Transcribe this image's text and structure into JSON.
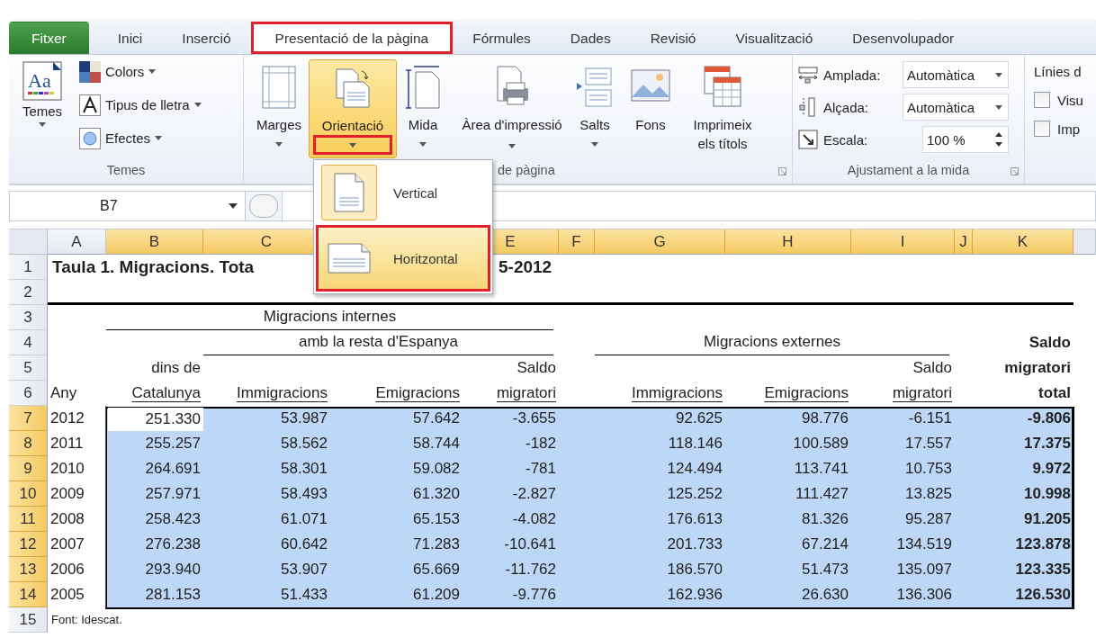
{
  "ribbon_tabs": [
    {
      "label": "Fitxer",
      "kind": "file",
      "selected": false,
      "highlighted": false
    },
    {
      "label": "Inici",
      "kind": "tab",
      "selected": false,
      "highlighted": false
    },
    {
      "label": "Inserció",
      "kind": "tab",
      "selected": false,
      "highlighted": false
    },
    {
      "label": "Presentació de la pàgina",
      "kind": "tab",
      "selected": true,
      "highlighted": true
    },
    {
      "label": "Fórmules",
      "kind": "tab",
      "selected": false,
      "highlighted": false
    },
    {
      "label": "Dades",
      "kind": "tab",
      "selected": false,
      "highlighted": false
    },
    {
      "label": "Revisió",
      "kind": "tab",
      "selected": false,
      "highlighted": false
    },
    {
      "label": "Visualització",
      "kind": "tab",
      "selected": false,
      "highlighted": false
    },
    {
      "label": "Desenvolupador",
      "kind": "tab",
      "selected": false,
      "highlighted": false
    }
  ],
  "themes_group": {
    "label": "Temes",
    "big_button": {
      "label": "Temes",
      "icon_text": "Aa"
    },
    "items": [
      {
        "label": "Colors",
        "kind": "colors"
      },
      {
        "label": "Tipus de lletra",
        "kind": "fonts"
      },
      {
        "label": "Efectes",
        "kind": "effects"
      }
    ]
  },
  "page_setup_group": {
    "label": "de pàgina",
    "buttons": [
      {
        "label": "Marges",
        "kind": "margins",
        "dropdown": true,
        "pressed": false,
        "highlighted": false
      },
      {
        "label": "Orientació",
        "kind": "orientation",
        "dropdown": true,
        "pressed": true,
        "highlighted": true
      },
      {
        "label": "Mida",
        "kind": "size",
        "dropdown": true,
        "pressed": false,
        "highlighted": false
      },
      {
        "label": "Àrea d'impressió",
        "kind": "print-area",
        "dropdown": true,
        "pressed": false,
        "highlighted": false
      },
      {
        "label": "Salts",
        "kind": "breaks",
        "dropdown": true,
        "pressed": false,
        "highlighted": false
      },
      {
        "label": "Fons",
        "kind": "background",
        "dropdown": false,
        "pressed": false,
        "highlighted": false
      },
      {
        "label": "Imprimeix els títols",
        "kind": "print-titles",
        "dropdown": false,
        "pressed": false,
        "highlighted": false
      }
    ]
  },
  "scale_group": {
    "label": "Ajustament a la mida",
    "rows": [
      {
        "label": "Amplada:",
        "kind": "dropdown",
        "value": "Automàtica"
      },
      {
        "label": "Alçada:",
        "kind": "dropdown",
        "value": "Automàtica"
      },
      {
        "label": "Escala:",
        "kind": "spinner",
        "value": "100 %"
      }
    ]
  },
  "sheet_options_group": {
    "label": "Línies d",
    "checkboxes": [
      {
        "label": "Visu",
        "checked": false
      },
      {
        "label": "Imp",
        "checked": false
      }
    ]
  },
  "name_box": {
    "value": "B7"
  },
  "orientation_menu": {
    "items": [
      {
        "label": "Vertical",
        "kind": "portrait",
        "selected": true,
        "hovered": false,
        "highlighted": false
      },
      {
        "label": "Horitzontal",
        "kind": "landscape",
        "selected": false,
        "hovered": true,
        "highlighted": true
      }
    ]
  },
  "sheet": {
    "columns": [
      {
        "label": "A",
        "selected": false
      },
      {
        "label": "B",
        "selected": true
      },
      {
        "label": "C",
        "selected": true
      },
      {
        "label": "E",
        "selected": true
      },
      {
        "label": "F",
        "selected": true
      },
      {
        "label": "G",
        "selected": true
      },
      {
        "label": "H",
        "selected": true
      },
      {
        "label": "I",
        "selected": true
      },
      {
        "label": "J",
        "selected": true
      },
      {
        "label": "K",
        "selected": true
      }
    ],
    "row_numbers": [
      {
        "label": "1",
        "selected": false
      },
      {
        "label": "2",
        "selected": false
      },
      {
        "label": "3",
        "selected": false
      },
      {
        "label": "4",
        "selected": false
      },
      {
        "label": "5",
        "selected": false
      },
      {
        "label": "6",
        "selected": false
      },
      {
        "label": "7",
        "selected": true
      },
      {
        "label": "8",
        "selected": true
      },
      {
        "label": "9",
        "selected": true
      },
      {
        "label": "10",
        "selected": true
      },
      {
        "label": "11",
        "selected": true
      },
      {
        "label": "12",
        "selected": true
      },
      {
        "label": "13",
        "selected": true
      },
      {
        "label": "14",
        "selected": true
      },
      {
        "label": "15",
        "selected": false
      }
    ],
    "title_left": "Taula 1. Migracions. Tota",
    "title_right": "5-2012",
    "internal_heading": "Migracions internes",
    "rest_of_spain_heading": "amb la resta d'Espanya",
    "external_heading": "Migracions externes",
    "header_row_5": {
      "b": "dins de",
      "e": "Saldo",
      "i": "Saldo"
    },
    "header_row_6": {
      "a": "Any",
      "b": "Catalunya",
      "c": "Immigracions",
      "d": "Emigracions",
      "e": "migratori",
      "g": "Immigracions",
      "h": "Emigracions",
      "i": "migratori"
    },
    "total_heading": [
      "Saldo",
      "migratori",
      "total"
    ],
    "rows": [
      {
        "year": "2012",
        "values": [
          "251.330",
          "53.987",
          "57.642",
          "-3.655",
          "92.625",
          "98.776",
          "-6.151"
        ],
        "total": "-9.806"
      },
      {
        "year": "2011",
        "values": [
          "255.257",
          "58.562",
          "58.744",
          "-182",
          "118.146",
          "100.589",
          "17.557"
        ],
        "total": "17.375"
      },
      {
        "year": "2010",
        "values": [
          "264.691",
          "58.301",
          "59.082",
          "-781",
          "124.494",
          "113.741",
          "10.753"
        ],
        "total": "9.972"
      },
      {
        "year": "2009",
        "values": [
          "257.971",
          "58.493",
          "61.320",
          "-2.827",
          "125.252",
          "111.427",
          "13.825"
        ],
        "total": "10.998"
      },
      {
        "year": "2008",
        "values": [
          "258.423",
          "61.071",
          "65.153",
          "-4.082",
          "176.613",
          "81.326",
          "95.287"
        ],
        "total": "91.205"
      },
      {
        "year": "2007",
        "values": [
          "276.238",
          "60.642",
          "71.283",
          "-10.641",
          "201.733",
          "67.214",
          "134.519"
        ],
        "total": "123.878"
      },
      {
        "year": "2006",
        "values": [
          "293.940",
          "53.907",
          "65.669",
          "-11.762",
          "186.570",
          "51.473",
          "135.097"
        ],
        "total": "123.335"
      },
      {
        "year": "2005",
        "values": [
          "281.153",
          "51.433",
          "61.209",
          "-9.776",
          "162.936",
          "26.630",
          "136.306"
        ],
        "total": "126.530"
      }
    ],
    "source": "Font: Idescat."
  }
}
